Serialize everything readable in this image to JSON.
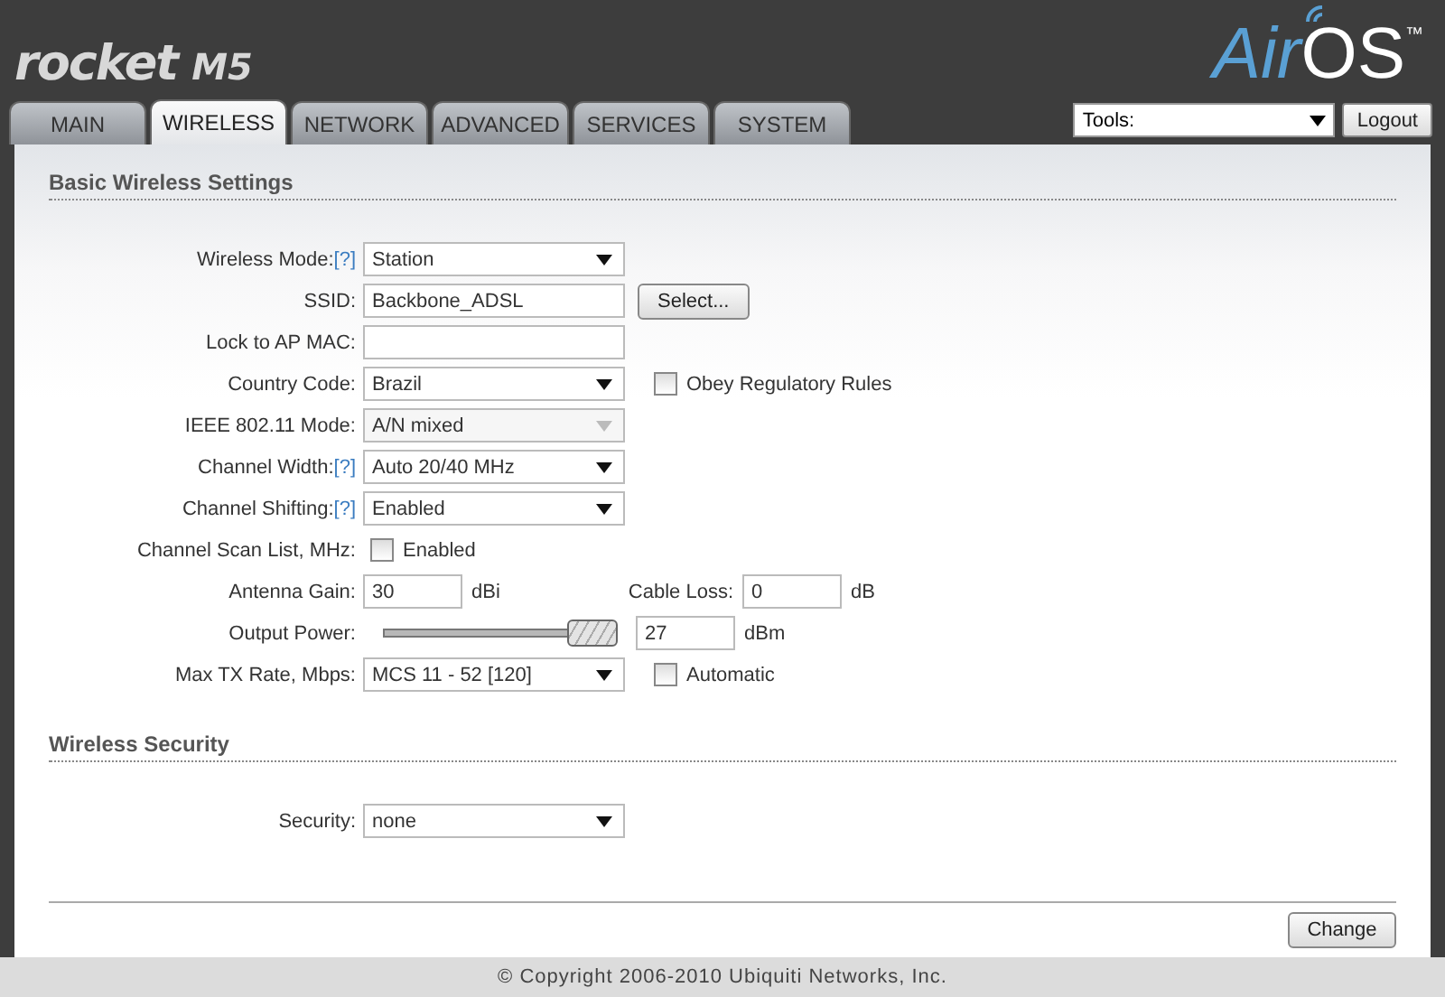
{
  "header": {
    "product": "rocket",
    "model": "M5",
    "brand_prefix": "Air",
    "brand_suffix": "OS",
    "trademark": "™"
  },
  "tabs": [
    {
      "label": "MAIN",
      "selected": false
    },
    {
      "label": "WIRELESS",
      "selected": true
    },
    {
      "label": "NETWORK",
      "selected": false
    },
    {
      "label": "ADVANCED",
      "selected": false
    },
    {
      "label": "SERVICES",
      "selected": false
    },
    {
      "label": "SYSTEM",
      "selected": false
    }
  ],
  "tools": {
    "value": "Tools:"
  },
  "logout": "Logout",
  "sections": [
    {
      "title": "Basic Wireless Settings",
      "rows": [
        {
          "kind": "select",
          "label": "Wireless Mode:",
          "help": "[?]",
          "value": "Station",
          "disabled": false
        },
        {
          "kind": "text",
          "label": "SSID:",
          "value": "Backbone_ADSL",
          "button": "Select..."
        },
        {
          "kind": "text",
          "label": "Lock to AP MAC:"
        },
        {
          "kind": "select",
          "label": "Country Code:",
          "value": "Brazil",
          "disabled": false,
          "checkbox": {
            "label": "Obey Regulatory Rules",
            "checked": false
          }
        },
        {
          "kind": "select",
          "label": "IEEE 802.11 Mode:",
          "value": "A/N mixed",
          "disabled": true
        },
        {
          "kind": "select",
          "label": "Channel Width:",
          "help": "[?]",
          "value": "Auto 20/40 MHz",
          "disabled": false
        },
        {
          "kind": "select",
          "label": "Channel Shifting:",
          "help": "[?]",
          "value": "Enabled",
          "disabled": false
        },
        {
          "kind": "checkbox",
          "label": "Channel Scan List, MHz:",
          "checkbox": {
            "label": "Enabled",
            "checked": false
          }
        },
        {
          "kind": "pair",
          "label": "Antenna Gain:",
          "value": "30",
          "unit": "dBi",
          "second": {
            "label": "Cable Loss:",
            "value": "0",
            "unit": "dB"
          }
        },
        {
          "kind": "slider",
          "label": "Output Power:",
          "level": 1,
          "value": "27",
          "unit": "dBm"
        },
        {
          "kind": "select",
          "label": "Max TX Rate, Mbps:",
          "value": "MCS 11 - 52 [120]",
          "disabled": false,
          "checkbox": {
            "label": "Automatic",
            "checked": false
          }
        }
      ]
    },
    {
      "title": "Wireless Security",
      "rows": [
        {
          "kind": "select",
          "label": "Security:",
          "value": "none",
          "disabled": false
        }
      ]
    }
  ],
  "change_button": "Change",
  "footer": "© Copyright 2006-2010 Ubiquiti Networks, Inc."
}
